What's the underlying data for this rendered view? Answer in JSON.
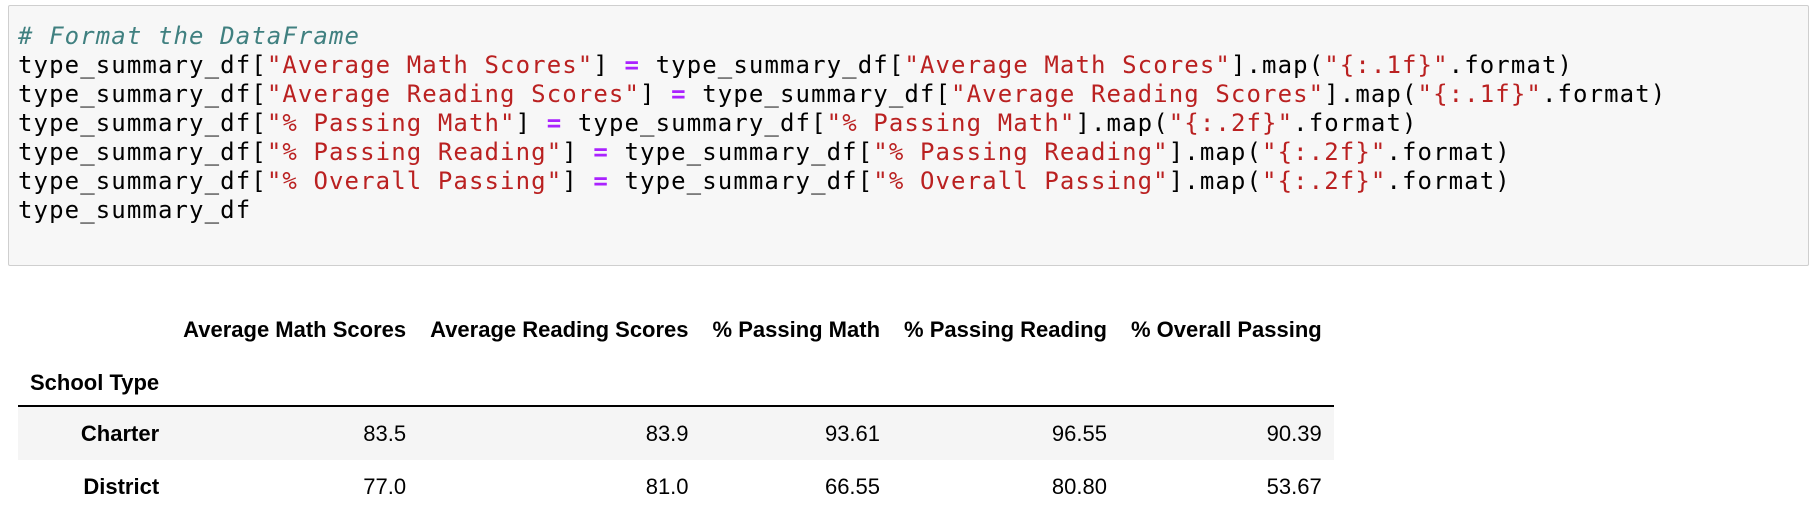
{
  "code_cell": {
    "comment": "# Format the DataFrame",
    "lines": [
      {
        "df": "type_summary_df",
        "col": "\"Average Math Scores\"",
        "fmt": "\"{:.1f}\""
      },
      {
        "df": "type_summary_df",
        "col": "\"Average Reading Scores\"",
        "fmt": "\"{:.1f}\""
      },
      {
        "df": "type_summary_df",
        "col": "\"% Passing Math\"",
        "fmt": "\"{:.2f}\""
      },
      {
        "df": "type_summary_df",
        "col": "\"% Passing Reading\"",
        "fmt": "\"{:.2f}\""
      },
      {
        "df": "type_summary_df",
        "col": "\"% Overall Passing\"",
        "fmt": "\"{:.2f}\""
      }
    ],
    "last_line": "type_summary_df"
  },
  "output_table": {
    "columns": [
      "Average Math Scores",
      "Average Reading Scores",
      "% Passing Math",
      "% Passing Reading",
      "% Overall Passing"
    ],
    "index_name": "School Type",
    "rows": [
      {
        "index": "Charter",
        "values": [
          "83.5",
          "83.9",
          "93.61",
          "96.55",
          "90.39"
        ]
      },
      {
        "index": "District",
        "values": [
          "77.0",
          "81.0",
          "66.55",
          "80.80",
          "53.67"
        ]
      }
    ]
  }
}
